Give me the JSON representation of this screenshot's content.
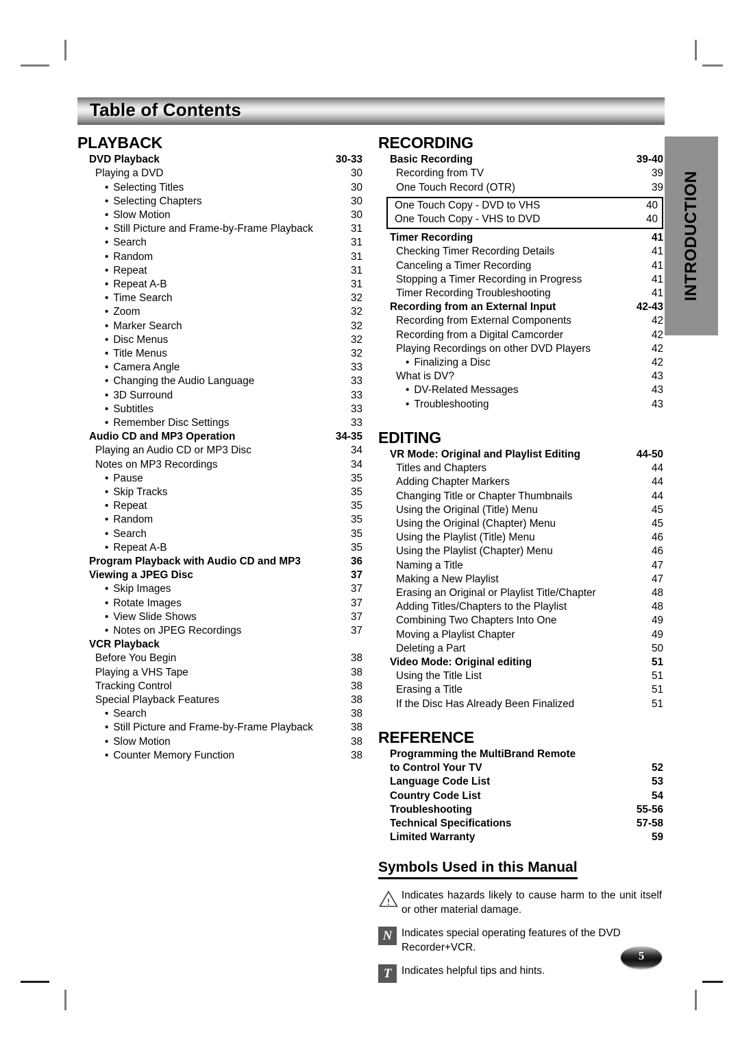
{
  "banner": {
    "title": "Table of Contents"
  },
  "side_tab": {
    "label": "INTRODUCTION"
  },
  "page_badge": {
    "number": "5"
  },
  "left_column": {
    "sections": [
      {
        "heading": "PLAYBACK",
        "entries": [
          {
            "level": 1,
            "label": "DVD Playback",
            "page": "30-33"
          },
          {
            "level": 2,
            "label": "Playing a DVD",
            "page": "30"
          },
          {
            "level": 3,
            "label": "Selecting Titles",
            "page": "30"
          },
          {
            "level": 3,
            "label": "Selecting Chapters",
            "page": "30"
          },
          {
            "level": 3,
            "label": "Slow Motion",
            "page": "30"
          },
          {
            "level": 3,
            "label": "Still Picture and Frame-by-Frame Playback",
            "page": "31"
          },
          {
            "level": 3,
            "label": "Search",
            "page": "31"
          },
          {
            "level": 3,
            "label": "Random",
            "page": "31"
          },
          {
            "level": 3,
            "label": "Repeat",
            "page": "31"
          },
          {
            "level": 3,
            "label": "Repeat A-B",
            "page": "31"
          },
          {
            "level": 3,
            "label": "Time Search",
            "page": "32"
          },
          {
            "level": 3,
            "label": "Zoom",
            "page": "32"
          },
          {
            "level": 3,
            "label": "Marker Search",
            "page": "32"
          },
          {
            "level": 3,
            "label": "Disc Menus",
            "page": "32"
          },
          {
            "level": 3,
            "label": "Title Menus",
            "page": "32"
          },
          {
            "level": 3,
            "label": "Camera Angle",
            "page": "33"
          },
          {
            "level": 3,
            "label": "Changing the Audio Language",
            "page": "33"
          },
          {
            "level": 3,
            "label": "3D Surround",
            "page": "33"
          },
          {
            "level": 3,
            "label": "Subtitles",
            "page": "33"
          },
          {
            "level": 3,
            "label": "Remember Disc Settings",
            "page": "33"
          },
          {
            "level": 1,
            "label": "Audio CD and MP3 Operation",
            "page": "34-35"
          },
          {
            "level": 2,
            "label": "Playing an Audio CD or MP3 Disc",
            "page": "34"
          },
          {
            "level": 2,
            "label": "Notes on MP3 Recordings",
            "page": "34"
          },
          {
            "level": 3,
            "label": "Pause",
            "page": "35"
          },
          {
            "level": 3,
            "label": "Skip Tracks",
            "page": "35"
          },
          {
            "level": 3,
            "label": "Repeat",
            "page": "35"
          },
          {
            "level": 3,
            "label": "Random",
            "page": "35"
          },
          {
            "level": 3,
            "label": "Search",
            "page": "35"
          },
          {
            "level": 3,
            "label": "Repeat A-B",
            "page": "35"
          },
          {
            "level": 1,
            "label": "Program Playback with Audio CD and MP3",
            "page": "36"
          },
          {
            "level": 1,
            "label": "Viewing a JPEG Disc",
            "page": "37"
          },
          {
            "level": 3,
            "label": "Skip Images",
            "page": "37"
          },
          {
            "level": 3,
            "label": "Rotate Images",
            "page": "37"
          },
          {
            "level": 3,
            "label": "View Slide Shows",
            "page": "37"
          },
          {
            "level": 3,
            "label": "Notes on JPEG Recordings",
            "page": "37"
          },
          {
            "level": 0,
            "label": "VCR Playback",
            "page": ""
          },
          {
            "level": 2,
            "label": "Before You Begin",
            "page": "38"
          },
          {
            "level": 2,
            "label": "Playing a VHS Tape",
            "page": "38"
          },
          {
            "level": 2,
            "label": "Tracking Control",
            "page": "38"
          },
          {
            "level": 2,
            "label": "Special Playback Features",
            "page": "38"
          },
          {
            "level": 3,
            "label": "Search",
            "page": "38"
          },
          {
            "level": 3,
            "label": "Still Picture and Frame-by-Frame Playback",
            "page": "38"
          },
          {
            "level": 3,
            "label": "Slow Motion",
            "page": "38"
          },
          {
            "level": 3,
            "label": "Counter Memory Function",
            "page": "38"
          }
        ]
      }
    ]
  },
  "right_column": {
    "recording": {
      "heading": "RECORDING",
      "entries_before_box": [
        {
          "level": 1,
          "label": "Basic Recording",
          "page": "39-40"
        },
        {
          "level": 2,
          "label": "Recording from TV",
          "page": "39"
        },
        {
          "level": 2,
          "label": "One Touch Record (OTR)",
          "page": "39"
        }
      ],
      "boxed_entries": [
        {
          "level": 2,
          "label": "One Touch Copy - DVD to VHS",
          "page": "40"
        },
        {
          "level": 2,
          "label": "One Touch Copy - VHS to DVD",
          "page": "40"
        }
      ],
      "entries_after_box": [
        {
          "level": 1,
          "label": "Timer Recording",
          "page": "41"
        },
        {
          "level": 2,
          "label": "Checking Timer Recording Details",
          "page": "41"
        },
        {
          "level": 2,
          "label": "Canceling a Timer Recording",
          "page": "41"
        },
        {
          "level": 2,
          "label": "Stopping a Timer Recording in Progress",
          "page": "41"
        },
        {
          "level": 2,
          "label": "Timer Recording Troubleshooting",
          "page": "41"
        },
        {
          "level": 1,
          "label": "Recording from an External Input",
          "page": "42-43"
        },
        {
          "level": 2,
          "label": "Recording from External Components",
          "page": "42"
        },
        {
          "level": 2,
          "label": "Recording from a Digital Camcorder",
          "page": "42"
        },
        {
          "level": 2,
          "label": "Playing Recordings on other DVD Players",
          "page": "42"
        },
        {
          "level": 3,
          "label": "Finalizing a Disc",
          "page": "42"
        },
        {
          "level": 2,
          "label": "What is DV?",
          "page": "43"
        },
        {
          "level": 3,
          "label": "DV-Related Messages",
          "page": "43"
        },
        {
          "level": 3,
          "label": "Troubleshooting",
          "page": "43"
        }
      ]
    },
    "editing": {
      "heading": "EDITING",
      "entries": [
        {
          "level": 1,
          "label": "VR Mode: Original and Playlist Editing",
          "page": "44-50"
        },
        {
          "level": 2,
          "label": "Titles and Chapters",
          "page": "44"
        },
        {
          "level": 2,
          "label": "Adding Chapter Markers",
          "page": "44"
        },
        {
          "level": 2,
          "label": "Changing Title or Chapter Thumbnails",
          "page": "44"
        },
        {
          "level": 2,
          "label": "Using the Original (Title) Menu",
          "page": "45"
        },
        {
          "level": 2,
          "label": "Using the Original (Chapter) Menu",
          "page": "45"
        },
        {
          "level": 2,
          "label": "Using the Playlist (Title) Menu",
          "page": "46"
        },
        {
          "level": 2,
          "label": "Using the Playlist (Chapter) Menu",
          "page": "46"
        },
        {
          "level": 2,
          "label": "Naming a Title",
          "page": "47"
        },
        {
          "level": 2,
          "label": "Making a New Playlist",
          "page": "47"
        },
        {
          "level": 2,
          "label": "Erasing an Original or Playlist Title/Chapter",
          "page": "48"
        },
        {
          "level": 2,
          "label": "Adding Titles/Chapters to the Playlist",
          "page": "48"
        },
        {
          "level": 2,
          "label": "Combining Two Chapters Into One",
          "page": "49"
        },
        {
          "level": 2,
          "label": "Moving a Playlist Chapter",
          "page": "49"
        },
        {
          "level": 2,
          "label": "Deleting a Part",
          "page": "50"
        },
        {
          "level": 1,
          "label": "Video Mode: Original editing",
          "page": "51"
        },
        {
          "level": 2,
          "label": "Using the Title List",
          "page": "51"
        },
        {
          "level": 2,
          "label": "Erasing a Title",
          "page": "51"
        },
        {
          "level": 2,
          "label": "If the Disc Has Already Been Finalized",
          "page": "51"
        }
      ]
    },
    "reference": {
      "heading": "REFERENCE",
      "entries": [
        {
          "level": 0,
          "label": "Programming the MultiBrand Remote",
          "page": ""
        },
        {
          "level": 1,
          "label": "to Control Your TV",
          "page": "52"
        },
        {
          "level": 1,
          "label": "Language Code List",
          "page": "53"
        },
        {
          "level": 1,
          "label": "Country Code List",
          "page": "54"
        },
        {
          "level": 1,
          "label": "Troubleshooting",
          "page": "55-56"
        },
        {
          "level": 1,
          "label": "Technical Specifications",
          "page": "57-58"
        },
        {
          "level": 1,
          "label": "Limited Warranty",
          "page": "59"
        }
      ]
    },
    "symbols": {
      "title": "Symbols Used in this Manual",
      "items": [
        {
          "icon": "warning-triangle-icon",
          "glyph": "",
          "text": "Indicates hazards likely to cause harm to the unit itself or other material damage."
        },
        {
          "icon": "note-n-icon",
          "glyph": "N",
          "text": "Indicates special operating features of the DVD Recorder+VCR."
        },
        {
          "icon": "tip-t-icon",
          "glyph": "T",
          "text": "Indicates helpful tips and hints."
        }
      ]
    }
  }
}
